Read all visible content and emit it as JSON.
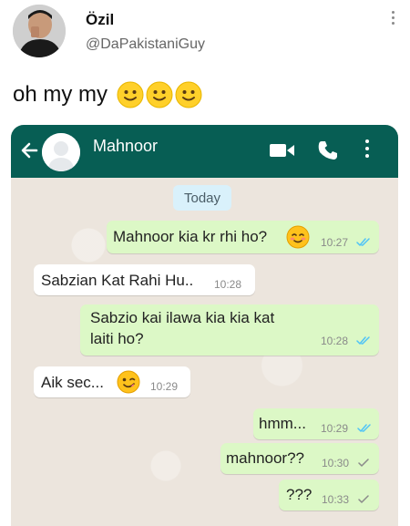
{
  "tweet": {
    "author_name": "Özil",
    "author_handle": "@DaPakistaniGuy",
    "text": "oh my my"
  },
  "whatsapp": {
    "contact_name": "Mahnoor",
    "date_label": "Today",
    "messages": [
      {
        "direction": "outgoing",
        "text": "Mahnoor kia kr rhi ho?",
        "time": "10:27",
        "status": "read"
      },
      {
        "direction": "incoming",
        "text": "Sabzian Kat Rahi Hu..",
        "time": "10:28"
      },
      {
        "direction": "outgoing",
        "text": "Sabzio kai ilawa kia kia kat laiti ho?",
        "line1": "Sabzio kai ilawa kia kia kat",
        "line2": "laiti ho?",
        "time": "10:28",
        "status": "read"
      },
      {
        "direction": "incoming",
        "text": "Aik sec...",
        "time": "10:29"
      },
      {
        "direction": "outgoing",
        "text": "hmm...",
        "time": "10:29",
        "status": "read"
      },
      {
        "direction": "outgoing",
        "text": "mahnoor??",
        "time": "10:30",
        "status": "delivered"
      },
      {
        "direction": "outgoing",
        "text": "???",
        "time": "10:33",
        "status": "delivered"
      }
    ]
  },
  "colors": {
    "wa_header": "#075e54",
    "outgoing_bubble": "#dcf8c6",
    "incoming_bubble": "#ffffff",
    "read_tick": "#4fc3f7",
    "delivered_tick": "#8a8a8a",
    "chat_background": "#ece5dd"
  },
  "icons": [
    "more-vertical-icon",
    "smiling-face-icon",
    "back-arrow-icon",
    "video-call-icon",
    "phone-icon",
    "menu-icon",
    "blush-emoji-icon",
    "wink-emoji-icon",
    "double-check-icon",
    "single-check-icon"
  ]
}
